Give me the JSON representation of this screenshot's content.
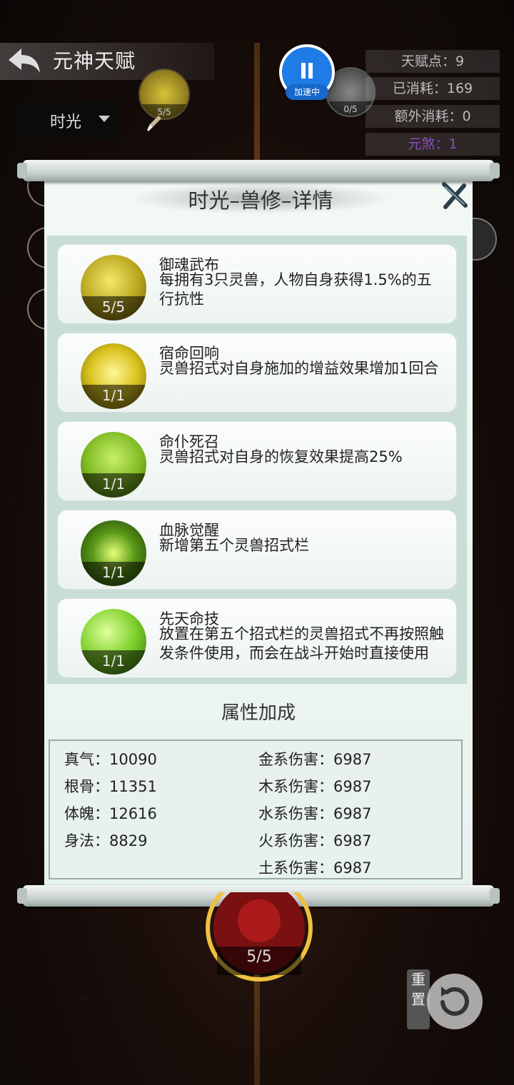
{
  "header": {
    "title": "元神天赋"
  },
  "dropdown": {
    "selected": "时光"
  },
  "nodes": {
    "top_left_count": "5/5",
    "top_right_count": "0/5",
    "bottom_count": "5/5"
  },
  "speed_button": {
    "label": "加速中"
  },
  "stats": {
    "talent_points": "天赋点：9",
    "consumed": "已消耗：169",
    "extra_consumed": "额外消耗：0",
    "yuan_sha": "元煞：1"
  },
  "panel": {
    "title": "时光–兽修–详情",
    "talents": [
      {
        "name": "御魂武布",
        "desc": "每拥有3只灵兽，人物自身获得1.5%的五行抗性",
        "level": "5/5"
      },
      {
        "name": "宿命回响",
        "desc": "灵兽招式对自身施加的增益效果增加1回合",
        "level": "1/1"
      },
      {
        "name": "命仆死召",
        "desc": "灵兽招式对自身的恢复效果提高25%",
        "level": "1/1"
      },
      {
        "name": "血脉觉醒",
        "desc": "新增第五个灵兽招式栏",
        "level": "1/1"
      },
      {
        "name": "先天命技",
        "desc": "放置在第五个招式栏的灵兽招式不再按照触发条件使用，而会在战斗开始时直接使用",
        "level": "1/1"
      }
    ],
    "attr_title": "属性加成",
    "attrs_left": [
      "真气：10090",
      "根骨：11351",
      "体魄：12616",
      "身法：8829"
    ],
    "attrs_right": [
      "金系伤害：6987",
      "木系伤害：6987",
      "水系伤害：6987",
      "火系伤害：6987",
      "土系伤害：6987"
    ]
  },
  "reset": {
    "label": "重置"
  },
  "colors": {
    "accent_blue": "#1f7be6",
    "purple_stat": "#8a4fb8"
  }
}
